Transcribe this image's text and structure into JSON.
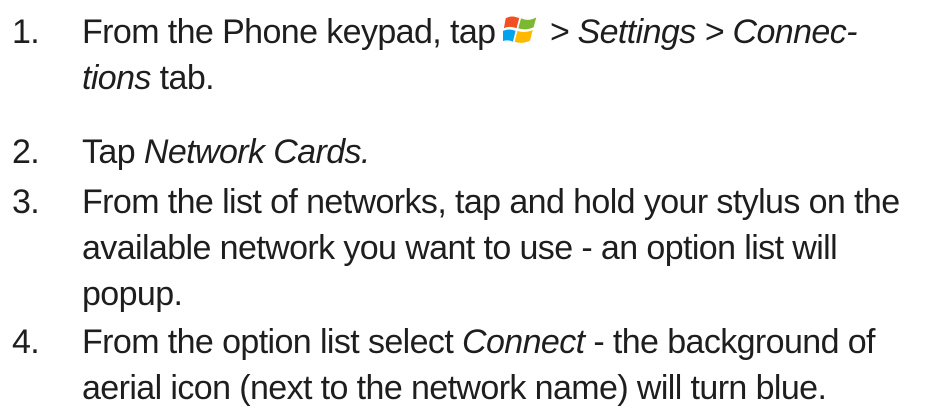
{
  "steps": [
    {
      "number": "1.",
      "line1_prefix": "From the Phone keypad, tap",
      "start_icon": "windows-start-flag-icon",
      "line1_path": "> Settings > Connec-",
      "line2_italic": "tions",
      "line2_suffix": " tab."
    },
    {
      "number": "2.",
      "prefix": "Tap ",
      "italic": "Network Cards."
    },
    {
      "number": "3.",
      "lines": [
        "From the list of networks, tap and hold your stylus on the",
        "available network you want to use - an option list will",
        "popup."
      ]
    },
    {
      "number": "4.",
      "line1_prefix": "From the option list select ",
      "line1_italic": "Connect",
      "line1_suffix": " - the background of",
      "line2": "aerial icon (next to the network name) will turn blue."
    }
  ]
}
